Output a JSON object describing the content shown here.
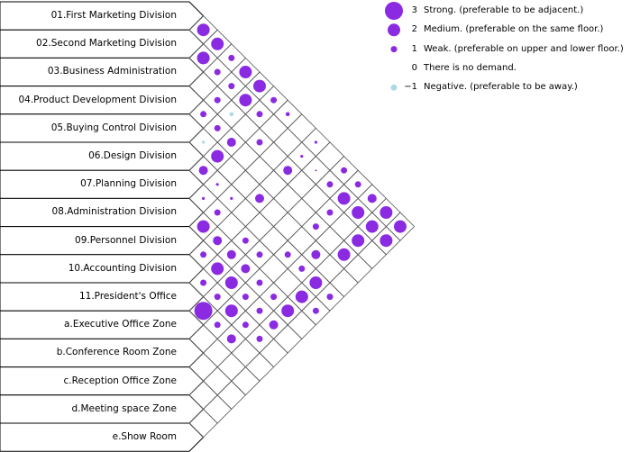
{
  "rows": [
    "01.First Marketing Division",
    "02.Second Marketing Division",
    "03.Business Administration",
    "04.Product Development Division",
    "05.Buying Control Division",
    "06.Design Division",
    "07.Planning Division",
    "08.Administration Division",
    "09.Personnel Division",
    "10.Accounting Division",
    "11.President's Office",
    "a.Executive Office Zone",
    "b.Conference Room Zone",
    "c.Reception Office Zone",
    "d.Meeting space Zone",
    "e.Show Room"
  ],
  "legend": [
    {
      "value": "3",
      "text": "Strong. (preferable to be adjacent.)",
      "level": 3
    },
    {
      "value": "2",
      "text": "Medium. (preferable on the same floor.)",
      "level": 2
    },
    {
      "value": "1",
      "text": "Weak. (preferable on upper and lower floor.)",
      "level": 1
    },
    {
      "value": "0",
      "text": "There is no demand.",
      "level": 0
    },
    {
      "value": "−1",
      "text": "Negative. (preferable to be away.)",
      "level": -1
    }
  ],
  "colors": {
    "positive": "#8a2be2",
    "negative": "#add8e6",
    "grid": "#555555"
  },
  "relations": [
    [
      0,
      1,
      2
    ],
    [
      0,
      2,
      2
    ],
    [
      1,
      2,
      2
    ],
    [
      0,
      3,
      1
    ],
    [
      1,
      3,
      1
    ],
    [
      0,
      4,
      2
    ],
    [
      1,
      4,
      1
    ],
    [
      0,
      5,
      2
    ],
    [
      2,
      4,
      1
    ],
    [
      1,
      5,
      2
    ],
    [
      0,
      6,
      1
    ],
    [
      3,
      4,
      1
    ],
    [
      2,
      5,
      -0.5
    ],
    [
      1,
      6,
      1
    ],
    [
      0,
      7,
      0.5
    ],
    [
      3,
      5,
      1
    ],
    [
      4,
      5,
      -0.25
    ],
    [
      3,
      6,
      1.5
    ],
    [
      2,
      7,
      1
    ],
    [
      0,
      9,
      0.25
    ],
    [
      4,
      6,
      2
    ],
    [
      1,
      9,
      0.25
    ],
    [
      5,
      6,
      1.5
    ],
    [
      2,
      9,
      1.5
    ],
    [
      1,
      10,
      0.1
    ],
    [
      0,
      11,
      1
    ],
    [
      5,
      7,
      0.25
    ],
    [
      1,
      11,
      1
    ],
    [
      0,
      12,
      1
    ],
    [
      6,
      7,
      0.25
    ],
    [
      5,
      8,
      0.25
    ],
    [
      4,
      9,
      1.5
    ],
    [
      1,
      12,
      2
    ],
    [
      0,
      13,
      1.5
    ],
    [
      6,
      8,
      1
    ],
    [
      2,
      12,
      1
    ],
    [
      1,
      13,
      2
    ],
    [
      0,
      14,
      2
    ],
    [
      7,
      8,
      2
    ],
    [
      3,
      12,
      1
    ],
    [
      1,
      14,
      2
    ],
    [
      0,
      15,
      2
    ],
    [
      7,
      9,
      1.5
    ],
    [
      6,
      10,
      1
    ],
    [
      2,
      14,
      2
    ],
    [
      1,
      15,
      2
    ],
    [
      8,
      9,
      1
    ],
    [
      7,
      10,
      1.5
    ],
    [
      6,
      11,
      1
    ],
    [
      5,
      12,
      1
    ],
    [
      4,
      13,
      1.5
    ],
    [
      3,
      14,
      2
    ],
    [
      8,
      10,
      2
    ],
    [
      7,
      11,
      1.5
    ],
    [
      5,
      13,
      1
    ],
    [
      9,
      10,
      1
    ],
    [
      8,
      11,
      2
    ],
    [
      7,
      12,
      1
    ],
    [
      5,
      14,
      2
    ],
    [
      9,
      11,
      1
    ],
    [
      8,
      12,
      1
    ],
    [
      7,
      13,
      1
    ],
    [
      6,
      14,
      2
    ],
    [
      5,
      15,
      1
    ],
    [
      10,
      11,
      3
    ],
    [
      9,
      12,
      2
    ],
    [
      8,
      13,
      1
    ],
    [
      7,
      14,
      2
    ],
    [
      6,
      15,
      1
    ],
    [
      10,
      12,
      1
    ],
    [
      9,
      13,
      1
    ],
    [
      8,
      14,
      1.5
    ],
    [
      10,
      13,
      1.5
    ],
    [
      9,
      14,
      1
    ]
  ]
}
